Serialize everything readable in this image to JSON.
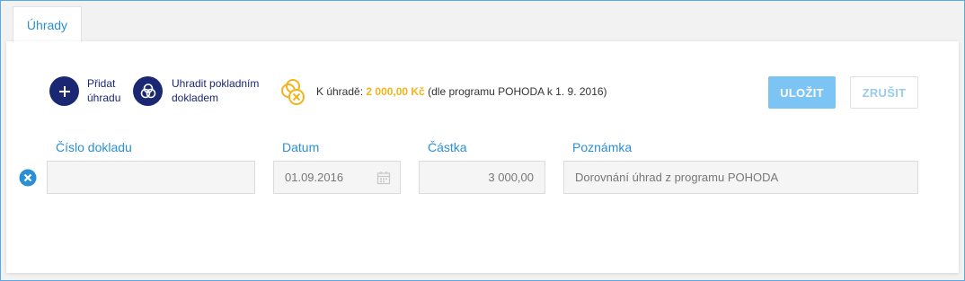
{
  "tab": {
    "label": "Úhrady"
  },
  "actions": {
    "add_payment": {
      "line1": "Přidat",
      "line2": "úhradu"
    },
    "pay_cash": {
      "line1": "Uhradit pokladním",
      "line2": "dokladem"
    }
  },
  "info": {
    "prefix": "K úhradě:",
    "amount": "2 000,00 Kč",
    "suffix": "(dle programu POHODA k 1. 9. 2016)"
  },
  "buttons": {
    "save": "ULOŽIT",
    "cancel": "ZRUŠIT"
  },
  "form": {
    "labels": {
      "doc_number": "Číslo dokladu",
      "date": "Datum",
      "amount": "Částka",
      "note": "Poznámka"
    },
    "row": {
      "doc_number": "",
      "date": "01.09.2016",
      "amount": "3 000,00",
      "note": "Dorovnání úhrad z programu POHODA"
    }
  },
  "colors": {
    "accent": "#2b8fd6",
    "navy": "#1a2874",
    "amount": "#f2b41d",
    "save_button": "#7cc4f4"
  },
  "icons": {
    "add": "plus-icon",
    "pay_cash": "coins-icon",
    "info": "coins-cancel-icon",
    "date": "calendar-icon",
    "remove": "close-circle-icon"
  }
}
